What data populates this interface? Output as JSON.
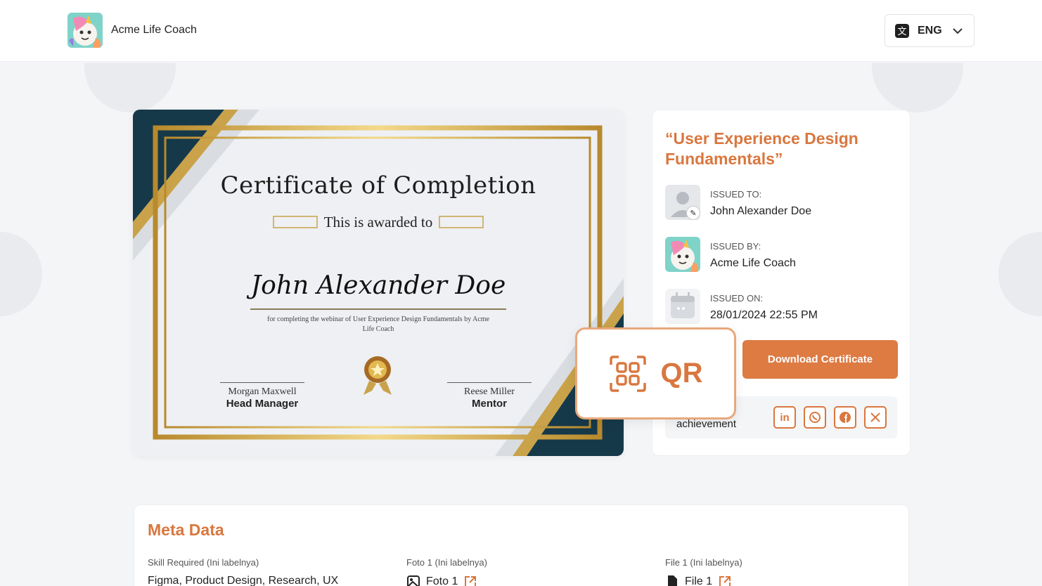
{
  "header": {
    "brand_name": "Acme Life Coach",
    "language": "ENG",
    "language_icon": "translate-icon"
  },
  "certificate": {
    "title": "Certificate of Completion",
    "awarded_text": "This is awarded to",
    "recipient": "John Alexander Doe",
    "description": "for completing the webinar of User Experience Design Fundamentals by Acme Life Coach",
    "signatures": [
      {
        "name": "Morgan Maxwell",
        "role": "Head Manager"
      },
      {
        "name": "Reese Miller",
        "role": "Mentor"
      }
    ]
  },
  "info": {
    "course_title": "“User Experience Design Fundamentals”",
    "issued_to_label": "ISSUED TO:",
    "issued_to_value": "John Alexander Doe",
    "issued_by_label": "ISSUED BY:",
    "issued_by_value": "Acme Life Coach",
    "issued_on_label": "ISSUED ON:",
    "issued_on_value": "28/01/2024 22:55 PM",
    "download_label": "Download Certificate",
    "share_text": "achievement",
    "socials": [
      "linkedin-icon",
      "whatsapp-icon",
      "facebook-icon",
      "x-icon"
    ]
  },
  "qr": {
    "label": "QR"
  },
  "meta": {
    "title": "Meta Data",
    "fields": [
      {
        "label": "Skill Required (Ini labelnya)",
        "value": "Figma, Product Design, Research, UX"
      },
      {
        "label": "Foto 1 (Ini labelnya)",
        "value": "Foto 1"
      },
      {
        "label": "File 1 (Ini labelnya)",
        "value": "File 1"
      }
    ]
  },
  "colors": {
    "accent": "#d9773f",
    "button": "#dd7b43",
    "cert_navy": "#16394a",
    "cert_gold": "#c9a24a"
  }
}
